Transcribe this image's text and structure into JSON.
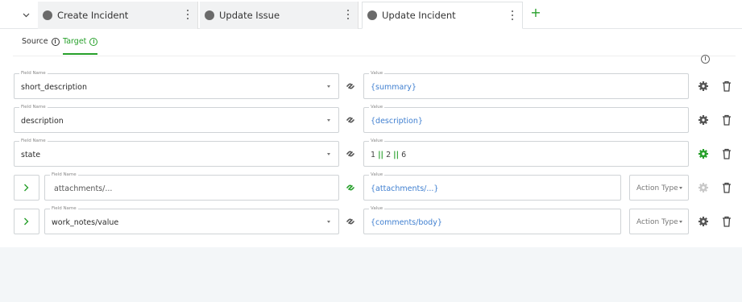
{
  "tabs": [
    {
      "label": "Create Incident",
      "active": false
    },
    {
      "label": "Update Issue",
      "active": false
    },
    {
      "label": "Update Incident",
      "active": true
    }
  ],
  "subtabs": [
    {
      "label": "Source",
      "active": false
    },
    {
      "label": "Target",
      "active": true
    }
  ],
  "colors": {
    "accent": "#27a02b",
    "value_blue": "#3f7fd0",
    "border": "#cfd3d6",
    "tab_dot": "#6a6a6a"
  },
  "rows": [
    {
      "field_label": "Field Name",
      "field_value": "short_description",
      "value_label": "Value",
      "value": "{summary}"
    },
    {
      "field_label": "Field Name",
      "field_value": "description",
      "value_label": "Value",
      "value": "{description}"
    },
    {
      "field_label": "Field Name",
      "field_value": "state",
      "value_label": "Value",
      "value_parts": [
        "1",
        "||",
        "2",
        "||",
        "6"
      ]
    },
    {
      "field_label": "Field Name",
      "field_value": "attachments/...",
      "value_label": "Value",
      "value": "{attachments/...}",
      "action_label": "Action Type"
    },
    {
      "field_label": "Field Name",
      "field_value": "work_notes/value",
      "value_label": "Value",
      "value": "{comments/body}",
      "action_label": "Action Type"
    }
  ]
}
